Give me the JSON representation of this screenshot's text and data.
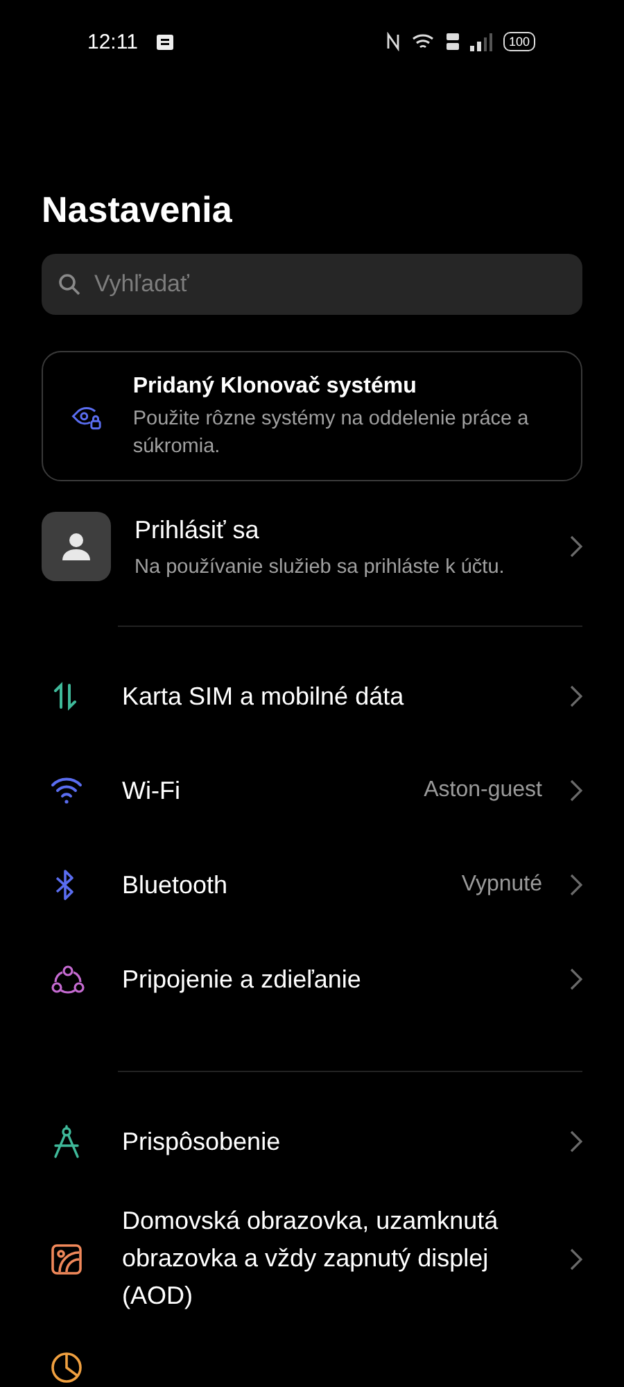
{
  "status_bar": {
    "time": "12:11",
    "battery": "100"
  },
  "title": "Nastavenia",
  "search": {
    "placeholder": "Vyhľadať"
  },
  "banner": {
    "title": "Pridaný Klonovač systému",
    "text": "Použite rôzne systémy na oddelenie práce a súkromia."
  },
  "account": {
    "title": "Prihlásiť sa",
    "subtitle": "Na používanie služieb sa prihláste k účtu."
  },
  "groups": [
    {
      "items": [
        {
          "label": "Karta SIM a mobilné dáta"
        },
        {
          "label": "Wi-Fi",
          "value": "Aston-guest"
        },
        {
          "label": "Bluetooth",
          "value": "Vypnuté"
        },
        {
          "label": "Pripojenie a zdieľanie"
        }
      ]
    },
    {
      "items": [
        {
          "label": "Prispôsobenie"
        },
        {
          "label": "Domovská obrazovka, uzamknutá obrazovka a vždy zapnutý displej (AOD)"
        }
      ]
    }
  ]
}
